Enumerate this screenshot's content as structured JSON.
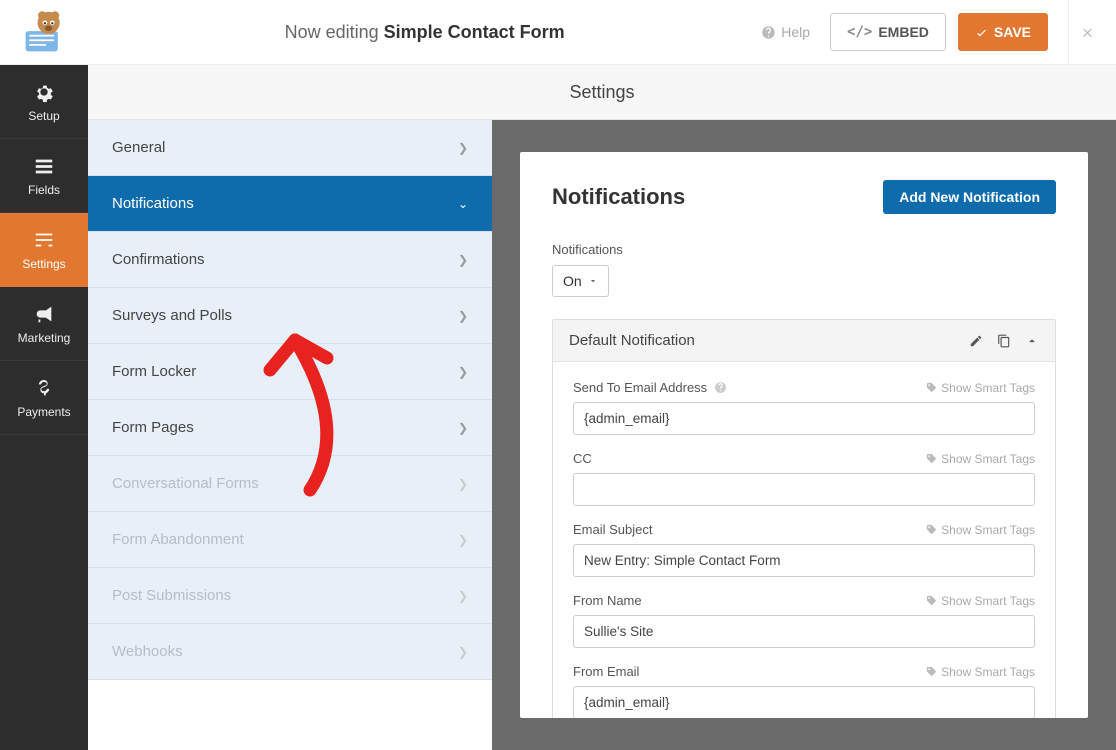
{
  "header": {
    "editing_prefix": "Now editing ",
    "form_name": "Simple Contact Form",
    "help_label": "Help",
    "embed_label": "EMBED",
    "save_label": "SAVE"
  },
  "sidebar": {
    "items": [
      {
        "label": "Setup"
      },
      {
        "label": "Fields"
      },
      {
        "label": "Settings"
      },
      {
        "label": "Marketing"
      },
      {
        "label": "Payments"
      }
    ]
  },
  "sub_panel": {
    "title": "Settings",
    "items": [
      {
        "label": "General",
        "state": "normal"
      },
      {
        "label": "Notifications",
        "state": "active"
      },
      {
        "label": "Confirmations",
        "state": "normal"
      },
      {
        "label": "Surveys and Polls",
        "state": "normal"
      },
      {
        "label": "Form Locker",
        "state": "normal"
      },
      {
        "label": "Form Pages",
        "state": "normal"
      },
      {
        "label": "Conversational Forms",
        "state": "disabled"
      },
      {
        "label": "Form Abandonment",
        "state": "disabled"
      },
      {
        "label": "Post Submissions",
        "state": "disabled"
      },
      {
        "label": "Webhooks",
        "state": "disabled"
      }
    ]
  },
  "content": {
    "heading": "Notifications",
    "add_button": "Add New Notification",
    "toggle_label": "Notifications",
    "toggle_value": "On",
    "notification": {
      "title": "Default Notification",
      "smart_tags_label": "Show Smart Tags",
      "fields": {
        "send_to": {
          "label": "Send To Email Address",
          "value": "{admin_email}"
        },
        "cc": {
          "label": "CC",
          "value": ""
        },
        "subject": {
          "label": "Email Subject",
          "value": "New Entry: Simple Contact Form"
        },
        "from_name": {
          "label": "From Name",
          "value": "Sullie's Site"
        },
        "from_email": {
          "label": "From Email",
          "value": "{admin_email}"
        }
      }
    }
  }
}
